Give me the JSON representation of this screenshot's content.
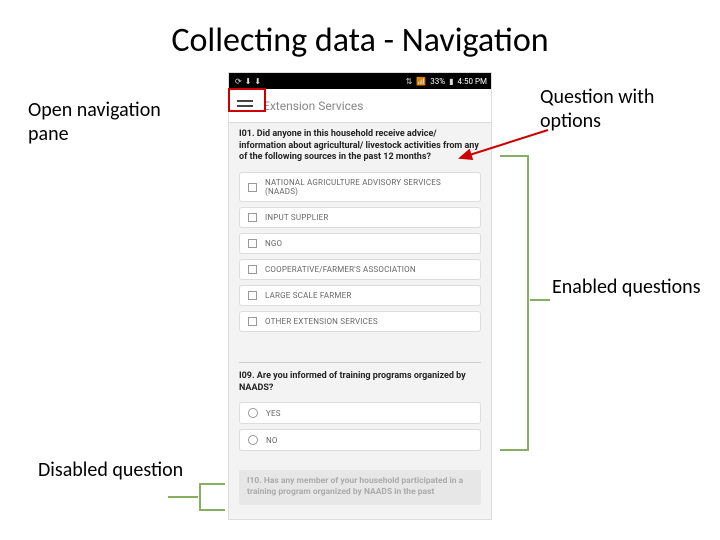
{
  "title": "Collecting data - Navigation",
  "annotations": {
    "open_nav": "Open navigation pane",
    "question_options": "Question with options",
    "enabled": "Enabled questions",
    "disabled": "Disabled question"
  },
  "phone": {
    "status": {
      "battery": "33%",
      "time": "4:50 PM"
    },
    "appbar_title": "Extension Services",
    "q1": {
      "text": "I01. Did anyone in this household receive advice/ information about agricultural/ livestock activities from any of the following sources in the past 12 months?",
      "options": [
        "NATIONAL AGRICULTURE ADVISORY SERVICES (NAADS)",
        "INPUT SUPPLIER",
        "NGO",
        "COOPERATIVE/FARMER'S ASSOCIATION",
        "LARGE SCALE FARMER",
        "OTHER EXTENSION SERVICES"
      ]
    },
    "q2": {
      "text": "I09. Are you informed of training programs organized by NAADS?",
      "options": [
        "YES",
        "NO"
      ]
    },
    "q3_disabled": {
      "text": "I10. Has any member of your household participated in a training program organized by NAADS in the past"
    }
  }
}
